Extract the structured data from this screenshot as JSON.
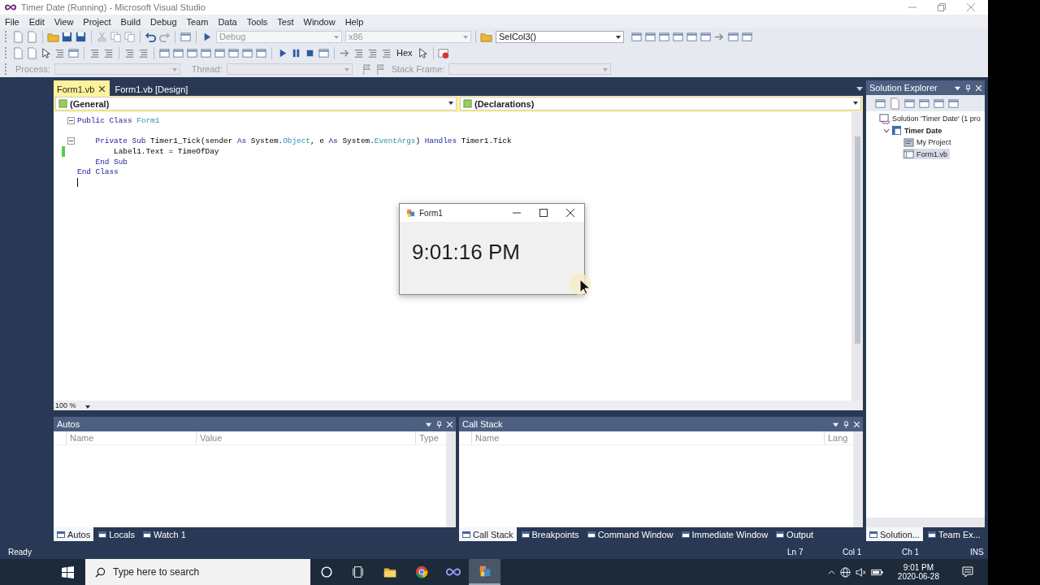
{
  "window": {
    "title": "Timer Date (Running) - Microsoft Visual Studio"
  },
  "menu": [
    "File",
    "Edit",
    "View",
    "Project",
    "Build",
    "Debug",
    "Team",
    "Data",
    "Tools",
    "Test",
    "Window",
    "Help"
  ],
  "toolbar": {
    "combos": [
      {
        "value": "Debug",
        "disabled": true
      },
      {
        "value": "x86",
        "disabled": true
      }
    ],
    "find": "SelCol3()",
    "hex": "Hex"
  },
  "debug_location": {
    "fields": [
      {
        "label": "Process:",
        "disabled": true
      },
      {
        "label": "Thread:",
        "disabled": true
      },
      {
        "label": "Stack Frame:",
        "disabled": true
      }
    ]
  },
  "document_tabs": [
    {
      "label": "Form1.vb",
      "selected": true
    },
    {
      "label": "Form1.vb [Design]",
      "selected": false
    }
  ],
  "editor": {
    "class_combo": "(General)",
    "member_combo": "(Declarations)",
    "zoom": "100 %",
    "lines": [
      {
        "collapsible": true,
        "changed": false,
        "gap_before": false,
        "tokens": [
          {
            "text": "Public Class ",
            "kind": "keyword"
          },
          {
            "text": "Form1",
            "kind": "type"
          }
        ]
      },
      {
        "collapsible": true,
        "changed": false,
        "gap_before": true,
        "tokens": [
          {
            "text": "    Private Sub ",
            "kind": "keyword"
          },
          {
            "text": "Timer1_Tick(sender ",
            "kind": "plain"
          },
          {
            "text": "As ",
            "kind": "keyword"
          },
          {
            "text": "System.",
            "kind": "plain"
          },
          {
            "text": "Object",
            "kind": "type"
          },
          {
            "text": ", e ",
            "kind": "plain"
          },
          {
            "text": "As ",
            "kind": "keyword"
          },
          {
            "text": "System.",
            "kind": "plain"
          },
          {
            "text": "EventArgs",
            "kind": "type"
          },
          {
            "text": ") ",
            "kind": "plain"
          },
          {
            "text": "Handles ",
            "kind": "keyword"
          },
          {
            "text": "Timer1.Tick",
            "kind": "plain"
          }
        ]
      },
      {
        "collapsible": false,
        "changed": true,
        "gap_before": false,
        "tokens": [
          {
            "text": "        Label1.Text = TimeOfDay",
            "kind": "plain"
          }
        ]
      },
      {
        "collapsible": false,
        "changed": false,
        "gap_before": false,
        "tokens": [
          {
            "text": "    End Sub",
            "kind": "keyword"
          }
        ]
      },
      {
        "collapsible": false,
        "changed": false,
        "gap_before": false,
        "tokens": [
          {
            "text": "End Class",
            "kind": "keyword"
          }
        ]
      }
    ]
  },
  "running_form": {
    "title": "Form1",
    "label": "9:01:16 PM"
  },
  "solution_explorer": {
    "title": "Solution Explorer",
    "tree": [
      {
        "label": "Solution 'Timer Date' (1 pro",
        "kind": "solution",
        "selected": false,
        "children": [
          {
            "label": "Timer Date",
            "kind": "project",
            "selected": false,
            "expanded": true,
            "children": [
              {
                "label": "My Project",
                "kind": "settings",
                "selected": false
              },
              {
                "label": "Form1.vb",
                "kind": "file",
                "selected": true
              }
            ]
          }
        ]
      }
    ],
    "tabs": [
      {
        "label": "Solution...",
        "selected": true
      },
      {
        "label": "Team Ex...",
        "selected": false
      }
    ]
  },
  "autos": {
    "title": "Autos",
    "columns": [
      "Name",
      "Value",
      "Type"
    ],
    "tabs": [
      {
        "label": "Autos",
        "selected": true
      },
      {
        "label": "Locals",
        "selected": false
      },
      {
        "label": "Watch 1",
        "selected": false
      }
    ]
  },
  "call_stack": {
    "title": "Call Stack",
    "columns": [
      "Name",
      "Lang"
    ],
    "tabs": [
      {
        "label": "Call Stack",
        "selected": true
      },
      {
        "label": "Breakpoints",
        "selected": false
      },
      {
        "label": "Command Window",
        "selected": false
      },
      {
        "label": "Immediate Window",
        "selected": false
      },
      {
        "label": "Output",
        "selected": false
      }
    ]
  },
  "status_bar": {
    "message": "Ready",
    "line": "Ln 7",
    "column": "Col 1",
    "char": "Ch 1",
    "mode": "INS"
  },
  "taskbar": {
    "search_placeholder": "Type here to search",
    "apps": [
      {
        "kind": "cortana",
        "selected": false
      },
      {
        "kind": "taskview",
        "selected": false
      },
      {
        "kind": "folder",
        "selected": false
      },
      {
        "kind": "browser",
        "selected": false
      },
      {
        "kind": "studio",
        "selected": false
      },
      {
        "kind": "formapp",
        "selected": true
      }
    ],
    "time": "9:01 PM",
    "date": "2020-06-28"
  }
}
